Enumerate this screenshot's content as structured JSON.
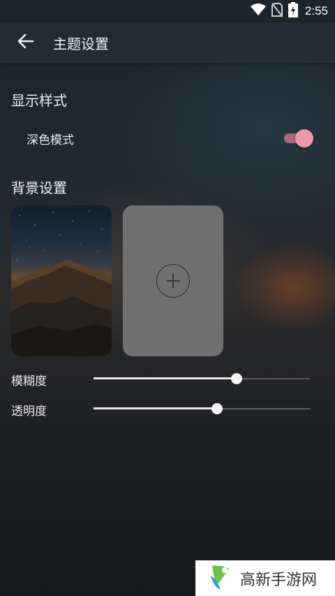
{
  "status_bar": {
    "time": "2:55",
    "icons": [
      "wifi-icon",
      "no-sim-icon",
      "battery-charging-icon"
    ]
  },
  "app_bar": {
    "back_icon": "arrow-left-icon",
    "title": "主题设置"
  },
  "display_section": {
    "title": "显示样式",
    "dark_mode": {
      "label": "深色模式",
      "enabled": true,
      "accent": "#ec9aab"
    }
  },
  "background_section": {
    "title": "背景设置",
    "thumbnails": [
      {
        "kind": "image",
        "description_icon": "mountain-night-photo"
      },
      {
        "kind": "add",
        "icon": "plus-circle-icon"
      }
    ]
  },
  "sliders": {
    "blur": {
      "label": "模糊度",
      "value": 0.66
    },
    "opacity": {
      "label": "透明度",
      "value": 0.57
    }
  },
  "watermark": {
    "text": "高新手游网",
    "logo_icon": "gaoxin-logo-icon"
  }
}
